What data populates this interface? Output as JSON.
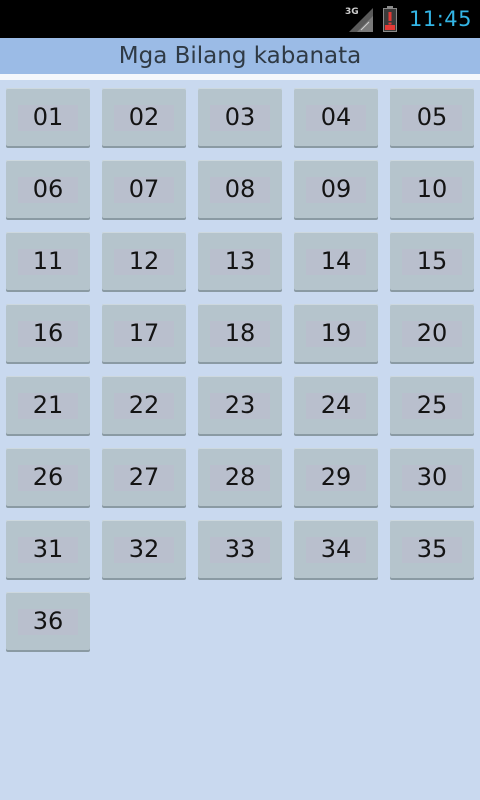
{
  "status_bar": {
    "network_label": "3G",
    "time": "11:45",
    "icons": [
      "signal-icon",
      "battery-alert-icon"
    ]
  },
  "header": {
    "title": "Mga Bilang kabanata"
  },
  "chapters": [
    "01",
    "02",
    "03",
    "04",
    "05",
    "06",
    "07",
    "08",
    "09",
    "10",
    "11",
    "12",
    "13",
    "14",
    "15",
    "16",
    "17",
    "18",
    "19",
    "20",
    "21",
    "22",
    "23",
    "24",
    "25",
    "26",
    "27",
    "28",
    "29",
    "30",
    "31",
    "32",
    "33",
    "34",
    "35",
    "36"
  ],
  "colors": {
    "background": "#c9d9ef",
    "title_bar": "#9bbbe6",
    "button": "#b5c4cc",
    "clock": "#33b5e5",
    "battery_alert": "#e53935"
  }
}
